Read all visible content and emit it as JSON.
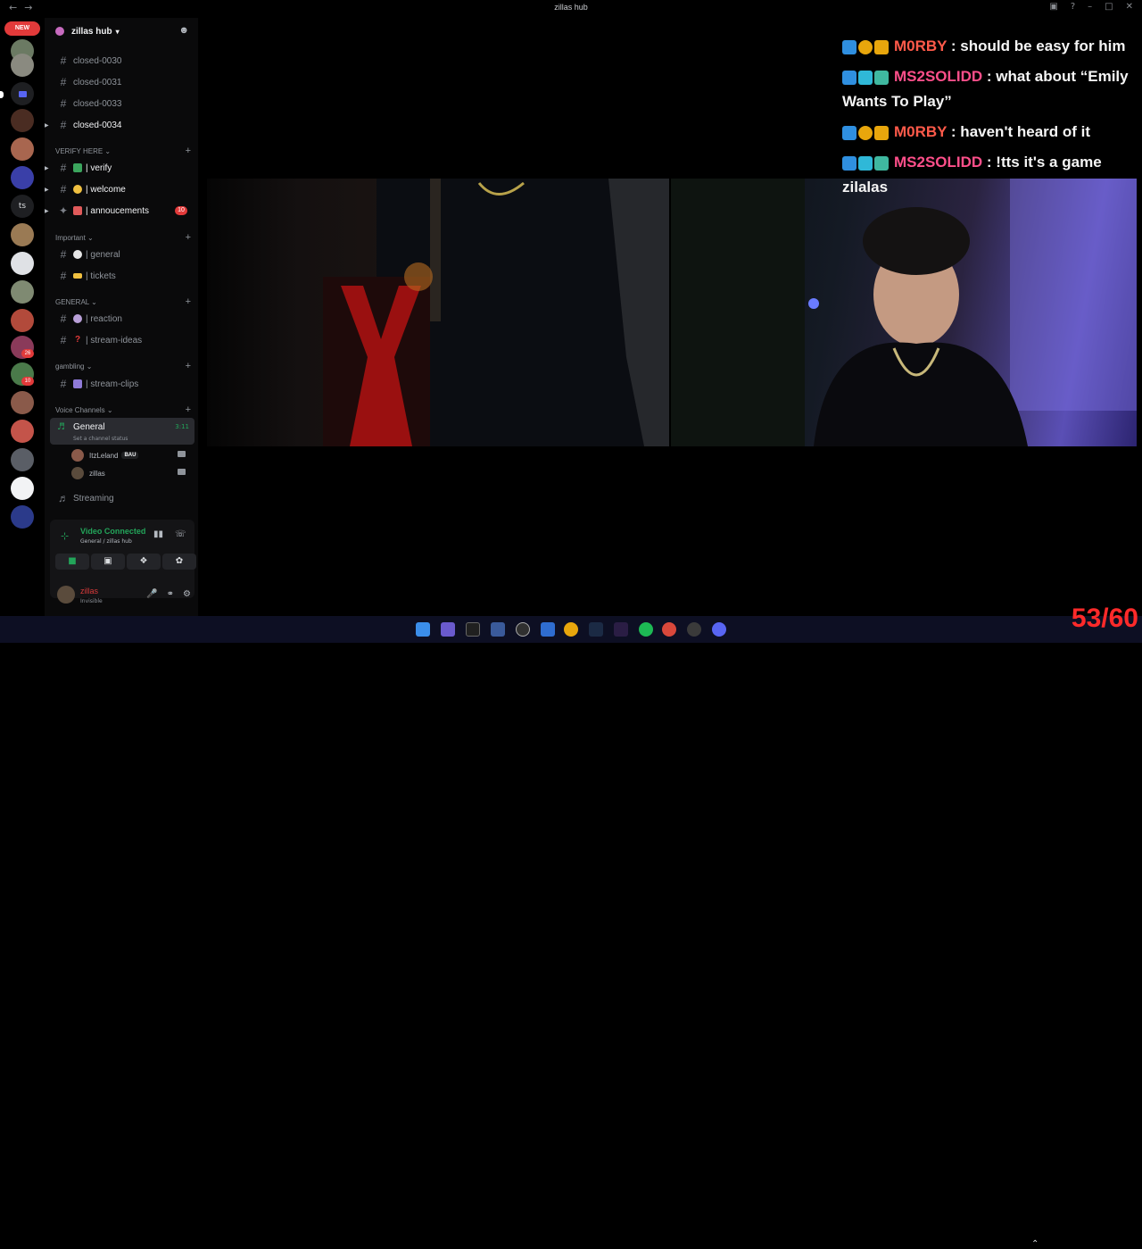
{
  "window": {
    "title": "zillas hub"
  },
  "servers": {
    "new_badge": "NEW",
    "ts_label": "ts",
    "badge1": "26",
    "badge2": "10"
  },
  "guild": {
    "name": "zillas hub"
  },
  "channels": {
    "items": [
      {
        "label": "closed-0030"
      },
      {
        "label": "closed-0031"
      },
      {
        "label": "closed-0033"
      },
      {
        "label": "closed-0034"
      }
    ],
    "verify_cat": "VERIFY HERE",
    "verify": "| verify",
    "welcome": "| welcome",
    "announcements": "| annoucements",
    "announcements_count": "10",
    "important_cat": "Important",
    "general": "| general",
    "tickets": "| tickets",
    "general_cat": "GENERAL",
    "reaction": "| reaction",
    "stream_ideas": "| stream-ideas",
    "gambling_cat": "gambling",
    "stream_clips": "| stream-clips",
    "voice_cat": "Voice Channels",
    "voice_general": "General",
    "voice_time": "3:11",
    "voice_status": "Set a channel status",
    "voice_users": [
      {
        "name": "ItzLeland",
        "tag": "BAU"
      },
      {
        "name": "zillas"
      }
    ],
    "streaming": "Streaming"
  },
  "voice_panel": {
    "title": "Video Connected",
    "subtitle": "General / zillas hub"
  },
  "user": {
    "name": "zillas",
    "status": "Invisible"
  },
  "chat": {
    "messages": [
      {
        "user": "M0RBY",
        "text": " : should be easy for him"
      },
      {
        "user": "MS2SOLIDD",
        "text": " : what about “Emily"
      },
      {
        "continuation": "Wants To Play”"
      },
      {
        "user": "M0RBY",
        "text": " : haven't heard of it"
      },
      {
        "user": "MS2SOLIDD",
        "text": " : !tts it's a game"
      },
      {
        "continuation": "zilalas"
      }
    ]
  },
  "overlay": {
    "fps": "53/60"
  },
  "colors": {
    "accent_green": "#23a55a",
    "mention_red": "#e23a3a",
    "chat_red": "#ff5a4a",
    "chat_pink": "#ff4f8a"
  }
}
